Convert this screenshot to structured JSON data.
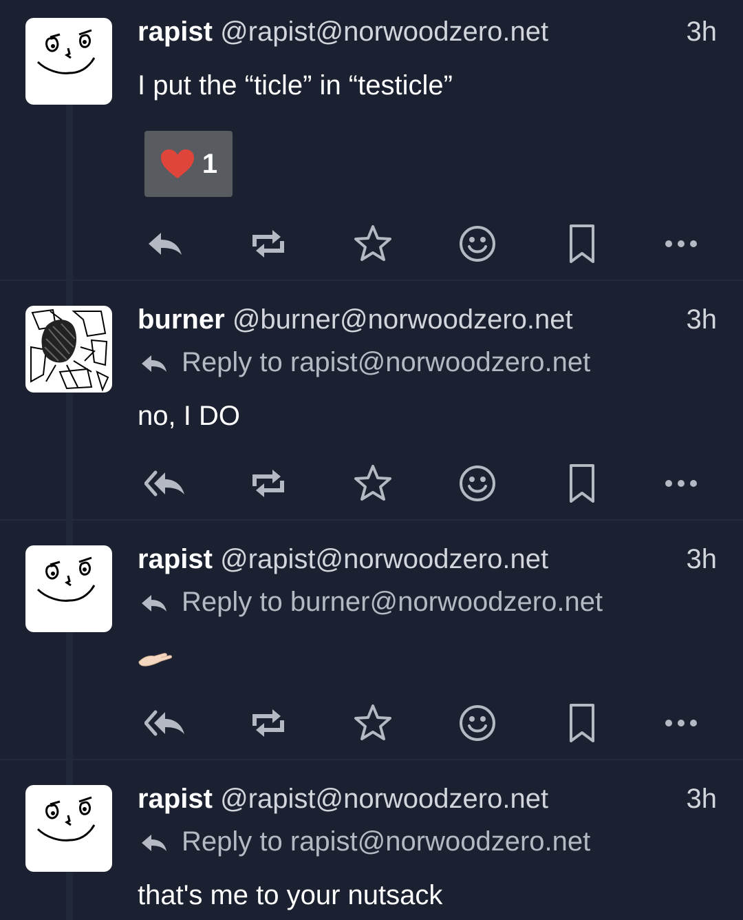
{
  "colors": {
    "background": "#1b2130",
    "text": "#ffffff",
    "muted": "#b4b9c3",
    "reaction_bg": "#585b60",
    "heart": "#e0453b"
  },
  "posts": [
    {
      "display_name": "rapist",
      "handle": "@rapist@norwoodzero.net",
      "time": "3h",
      "reply_to": "",
      "content": "I put the “ticle” in “testicle”",
      "avatar": "smiley-face-drawing",
      "reaction": {
        "icon": "heart-icon",
        "count": "1"
      },
      "reply_icon": "reply-icon"
    },
    {
      "display_name": "burner",
      "handle": "@burner@norwoodzero.net",
      "time": "3h",
      "reply_to": "Reply to rapist@norwoodzero.net",
      "content": "no, I DO",
      "avatar": "scribble-drawing",
      "reply_icon": "reply-all-icon"
    },
    {
      "display_name": "rapist",
      "handle": "@rapist@norwoodzero.net",
      "time": "3h",
      "reply_to": "Reply to burner@norwoodzero.net",
      "content": "🫴",
      "avatar": "smiley-face-drawing",
      "reply_icon": "reply-all-icon"
    },
    {
      "display_name": "rapist",
      "handle": "@rapist@norwoodzero.net",
      "time": "3h",
      "reply_to": "Reply to rapist@norwoodzero.net",
      "content": "that's me to your nutsack",
      "avatar": "smiley-face-drawing"
    }
  ],
  "action_icons": [
    "reply-icon",
    "boost-icon",
    "star-icon",
    "emoji-icon",
    "bookmark-icon",
    "more-icon"
  ]
}
